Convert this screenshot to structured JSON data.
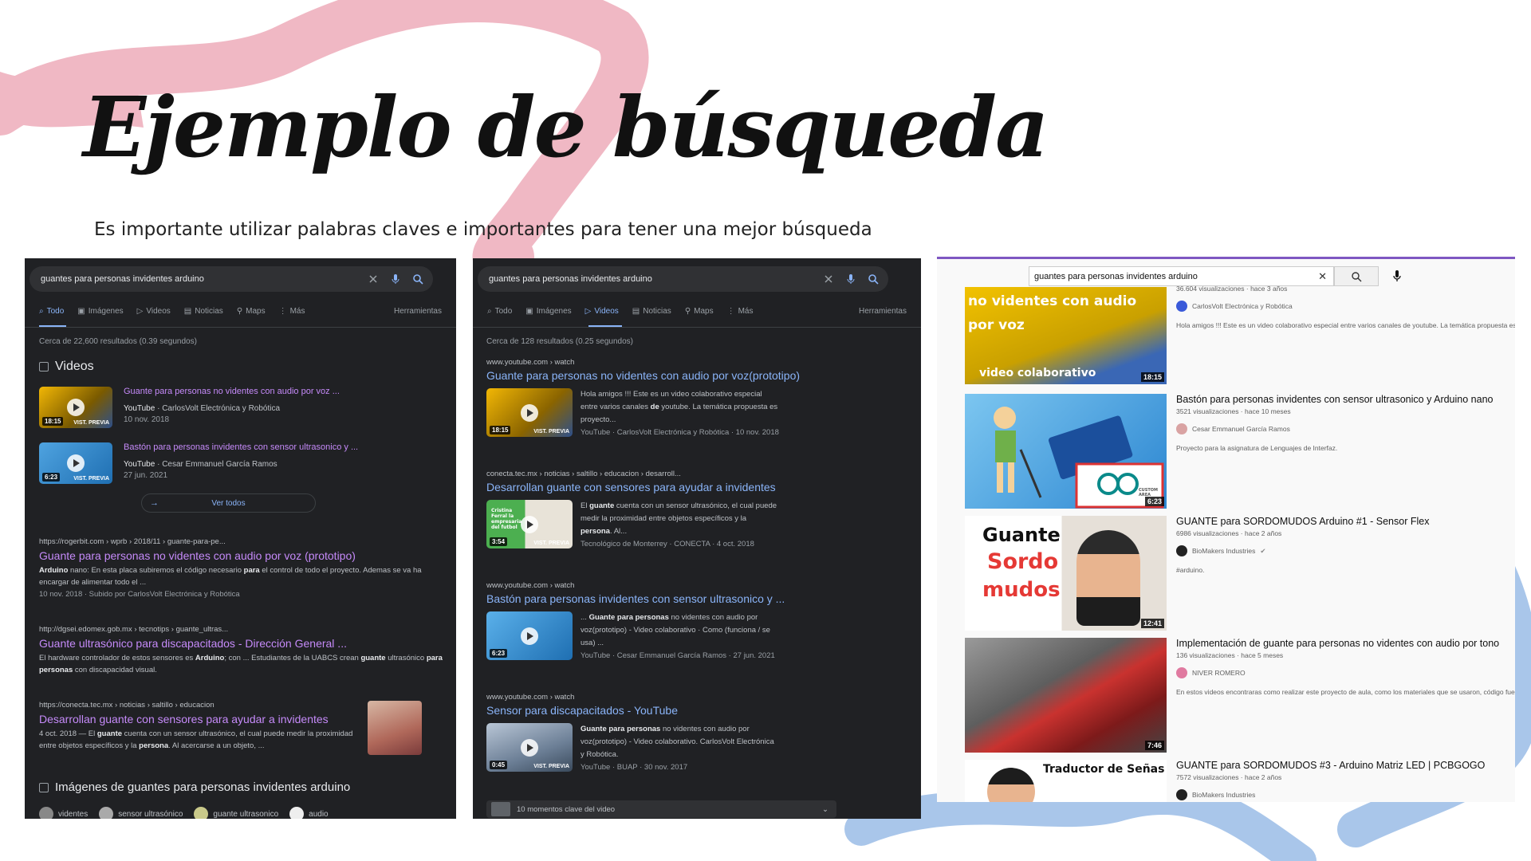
{
  "slide": {
    "title": "Ejemplo de búsqueda",
    "subtitle": "Es importante utilizar palabras claves e importantes para tener una mejor búsqueda"
  },
  "colors": {
    "deco_pink": "#f0b8c4",
    "deco_blue": "#a9c6ea",
    "google_bg": "#202124",
    "link_visited": "#c58af9",
    "link_blue": "#8ab4f8",
    "yt_accent": "#7e57c2"
  },
  "panel1": {
    "query": "guantes para personas invidentes arduino",
    "tabs": [
      "Todo",
      "Imágenes",
      "Videos",
      "Noticias",
      "Maps",
      "Más"
    ],
    "tools": "Herramientas",
    "stats": "Cerca de 22,600 resultados (0.39 segundos)",
    "videos_heading": "Videos",
    "videos": [
      {
        "title": "Guante para personas no videntes con audio por voz ...",
        "source": "YouTube",
        "channel": "CarlosVolt Electrónica y Robótica",
        "date": "10 nov. 2018",
        "duration": "18:15",
        "badge": "VIST. PREVIA"
      },
      {
        "title": "Bastón para personas invidentes con sensor ultrasonico y ...",
        "source": "YouTube",
        "channel": "Cesar Emmanuel García Ramos",
        "date": "27 jun. 2021",
        "duration": "6:23",
        "badge": "VIST. PREVIA"
      }
    ],
    "see_all": "Ver todos",
    "results": [
      {
        "url": "https://rogerbit.com › wprb › 2018/11 › guante-para-pe...",
        "title": "Guante para personas no videntes con audio por voz (prototipo)",
        "s1": "Arduino",
        "s2": " nano: En esta placa subiremos el código necesario ",
        "s3": "para",
        "s4": " el control de todo el proyecto. Ademas se va ha encargar de alimentar todo el ...",
        "meta": "10 nov. 2018 · Subido por CarlosVolt Electrónica y Robótica"
      },
      {
        "url": "http://dgsei.edomex.gob.mx › tecnotips › guante_ultras...",
        "title": "Guante ultrasónico para discapacitados - Dirección General ...",
        "s1": "El hardware controlador de estos sensores es ",
        "s2": "Arduino",
        "s3": "; con ... Estudiantes de la UABCS crean ",
        "s4": "guante",
        "s5": " ultrasónico ",
        "s6": "para personas",
        "s7": " con discapacidad visual."
      },
      {
        "url": "https://conecta.tec.mx › noticias › saltillo › educacion",
        "title": "Desarrollan guante con sensores para ayudar a invidentes",
        "s1": "4 oct. 2018 — El ",
        "s2": "guante",
        "s3": " cuenta con un sensor ultrasónico, el cual puede medir la proximidad entre objetos específicos y la ",
        "s4": "persona",
        "s5": ". Al acercarse a un objeto, ..."
      }
    ],
    "images_heading": "Imágenes de guantes para personas invidentes arduino",
    "image_chips": [
      "videntes",
      "sensor ultrasónico",
      "guante ultrasonico",
      "audio"
    ]
  },
  "panel2": {
    "query": "guantes para personas invidentes arduino",
    "tabs": [
      "Todo",
      "Imágenes",
      "Videos",
      "Noticias",
      "Maps",
      "Más"
    ],
    "tools": "Herramientas",
    "stats": "Cerca de 128 resultados (0.25 segundos)",
    "results": [
      {
        "url": "www.youtube.com › watch",
        "title": "Guante para personas no videntes con audio por voz(prototipo)",
        "d1": "Hola amigos !!! Este es un video colaborativo especial entre varios canales ",
        "d2": "de",
        "d3": " youtube. La temática propuesta es proyecto...",
        "meta": "YouTube · CarlosVolt Electrónica y Robótica · 10 nov. 2018",
        "duration": "18:15",
        "badge": "VIST. PREVIA"
      },
      {
        "url": "conecta.tec.mx › noticias › saltillo › educacion › desarroll...",
        "title": "Desarrollan guante con sensores para ayudar a invidentes",
        "d1": "El ",
        "d2": "guante",
        "d3": " cuenta con un sensor ultrasónico, el cual puede medir la proximidad entre objetos específicos y la ",
        "d4": "persona",
        "d5": ". Al...",
        "meta": "Tecnológico de Monterrey · CONECTA · 4 oct. 2018",
        "duration": "3:54",
        "badge": "VIST. PREVIA",
        "thumb_caption": "Cristina Ferral la empresaria del futbol"
      },
      {
        "url": "www.youtube.com › watch",
        "title": "Bastón para personas invidentes con sensor ultrasonico y ...",
        "d1": "... ",
        "d2": "Guante para personas",
        "d3": " no videntes con audio por voz(prototipo) - Video colaborativo · Como (funciona / se usa) ...",
        "meta": "YouTube · Cesar Emmanuel García Ramos · 27 jun. 2021",
        "duration": "6:23"
      },
      {
        "url": "www.youtube.com › watch",
        "title": "Sensor para discapacitados - YouTube",
        "d1": "",
        "d2": "Guante para personas",
        "d3": " no videntes con audio por voz(prototipo) - Video colaborativo. CarlosVolt Electrónica y Robótica.",
        "meta": "YouTube · BUAP · 30 nov. 2017",
        "duration": "0:45",
        "badge": "VIST. PREVIA"
      }
    ],
    "moments": "10 momentos clave del video"
  },
  "panel3": {
    "query": "guantes para personas invidentes arduino",
    "videos": [
      {
        "title": "",
        "views": "36.604 visualizaciones · hace 3 años",
        "channel": "CarlosVolt Electrónica y Robótica",
        "desc": "Hola amigos !!! Este es un video colaborativo especial entre varios canales de youtube. La temática propuesta es",
        "duration": "18:15",
        "thumb_text1": "no videntes con audio",
        "thumb_text2": "por voz",
        "thumb_text3": "video colaborativo"
      },
      {
        "title": "Bastón para personas invidentes con sensor ultrasonico y Arduino nano",
        "views": "3521 visualizaciones · hace 10 meses",
        "channel": "Cesar Emmanuel García Ramos",
        "desc": "Proyecto para la asignatura de Lenguajes de Interfaz.",
        "duration": "6:23",
        "thumb_text1": "CUSTOM AREA"
      },
      {
        "title": "GUANTE para SORDOMUDOS Arduino #1 - Sensor Flex",
        "views": "6986 visualizaciones · hace 2 años",
        "channel": "BioMakers Industries",
        "desc": "#arduino.",
        "duration": "12:41",
        "thumb_text1": "Guante",
        "thumb_text2": "Sordo",
        "thumb_text3": "mudos"
      },
      {
        "title": "Implementación de guante para personas no videntes con audio por tono",
        "views": "136 visualizaciones · hace 5 meses",
        "channel": "NIVER ROMERO",
        "desc": "En estos videos encontraras como realizar este proyecto de aula, como los materiales que se usaron, código fuen",
        "duration": "7:46"
      },
      {
        "title": "GUANTE para SORDOMUDOS #3 - Arduino Matriz LED | PCBGOGO",
        "views": "7572 visualizaciones · hace 2 años",
        "channel": "BioMakers Industries",
        "desc": "",
        "thumb_text1": "Traductor de Señas"
      }
    ]
  }
}
